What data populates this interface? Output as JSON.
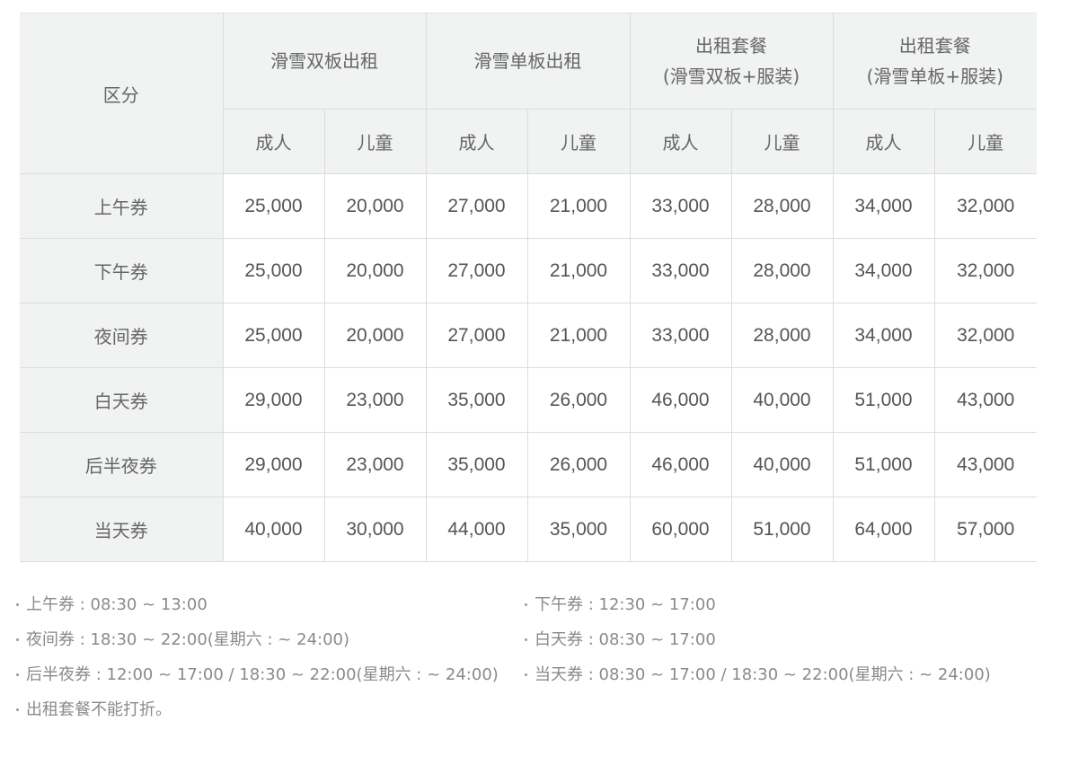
{
  "table": {
    "corner_label": "区分",
    "groups": [
      {
        "title": "滑雪双板出租"
      },
      {
        "title": "滑雪单板出租"
      },
      {
        "title": "出租套餐\n(滑雪双板+服装)"
      },
      {
        "title": "出租套餐\n(滑雪单板+服装)"
      }
    ],
    "sub_headers": [
      "成人",
      "儿童",
      "成人",
      "儿童",
      "成人",
      "儿童",
      "成人",
      "儿童"
    ],
    "rows": [
      {
        "label": "上午券",
        "values": [
          "25,000",
          "20,000",
          "27,000",
          "21,000",
          "33,000",
          "28,000",
          "34,000",
          "32,000"
        ]
      },
      {
        "label": "下午券",
        "values": [
          "25,000",
          "20,000",
          "27,000",
          "21,000",
          "33,000",
          "28,000",
          "34,000",
          "32,000"
        ]
      },
      {
        "label": "夜间券",
        "values": [
          "25,000",
          "20,000",
          "27,000",
          "21,000",
          "33,000",
          "28,000",
          "34,000",
          "32,000"
        ]
      },
      {
        "label": "白天券",
        "values": [
          "29,000",
          "23,000",
          "35,000",
          "26,000",
          "46,000",
          "40,000",
          "51,000",
          "43,000"
        ]
      },
      {
        "label": "后半夜券",
        "values": [
          "29,000",
          "23,000",
          "35,000",
          "26,000",
          "46,000",
          "40,000",
          "51,000",
          "43,000"
        ]
      },
      {
        "label": "当天券",
        "values": [
          "40,000",
          "30,000",
          "44,000",
          "35,000",
          "60,000",
          "51,000",
          "64,000",
          "57,000"
        ]
      }
    ]
  },
  "notes": [
    "上午券 : 08:30 ~ 13:00",
    "下午券 : 12:30 ~ 17:00",
    "夜间券 : 18:30 ~ 22:00(星期六 : ~ 24:00)",
    "白天券 : 08:30 ~ 17:00",
    "后半夜券 : 12:00 ~ 17:00 / 18:30 ~ 22:00(星期六 : ~ 24:00)",
    "当天券 : 08:30 ~ 17:00 / 18:30 ~ 22:00(星期六 : ~ 24:00)",
    "出租套餐不能打折。"
  ]
}
